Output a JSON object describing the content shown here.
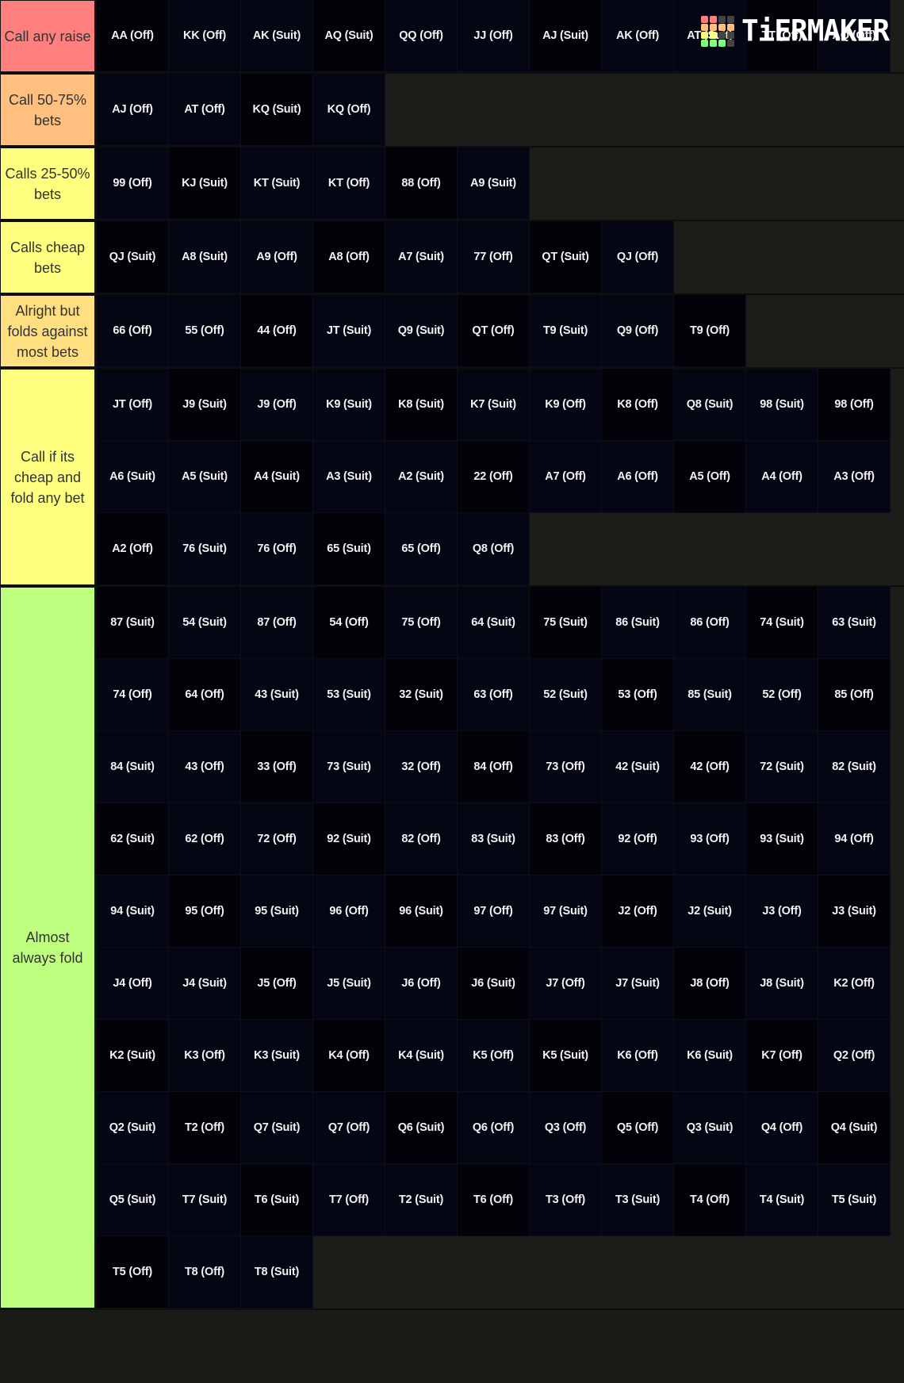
{
  "logo": {
    "text": "TiERMAKER",
    "grid_colors": [
      "#ff7f7f",
      "#ff7f7f",
      "#444444",
      "#444444",
      "#ffbf7f",
      "#ffbf7f",
      "#ffbf7f",
      "#ffbf7f",
      "#ffff7f",
      "#ffff7f",
      "#444444",
      "#444444",
      "#7fff7f",
      "#7fff7f",
      "#7fff7f",
      "#444444"
    ]
  },
  "tiers": [
    {
      "label": "Call any raise",
      "color": "#ff7f7f",
      "items": [
        "AA (Off)",
        "KK (Off)",
        "AK (Suit)",
        "AQ (Suit)",
        "QQ (Off)",
        "JJ (Off)",
        "AJ (Suit)",
        "AK (Off)",
        "AT (Suit)",
        "TT (Off)",
        "AQ (Off)"
      ]
    },
    {
      "label": "Call 50-75% bets",
      "color": "#ffbf7f",
      "items": [
        "AJ (Off)",
        "AT (Off)",
        "KQ (Suit)",
        "KQ (Off)"
      ]
    },
    {
      "label": "Calls 25-50% bets",
      "color": "#ffff7f",
      "items": [
        "99 (Off)",
        "KJ (Suit)",
        "KT (Suit)",
        "KT (Off)",
        "88 (Off)",
        "A9 (Suit)"
      ]
    },
    {
      "label": "Calls cheap bets",
      "color": "#ffff7f",
      "items": [
        "QJ (Suit)",
        "A8 (Suit)",
        "A9 (Off)",
        "A8 (Off)",
        "A7 (Suit)",
        "77 (Off)",
        "QT (Suit)",
        "QJ (Off)"
      ]
    },
    {
      "label": "Alright but folds against most bets",
      "color": "#ffdf80",
      "items": [
        "66 (Off)",
        "55 (Off)",
        "44 (Off)",
        "JT (Suit)",
        "Q9 (Suit)",
        "QT (Off)",
        "T9 (Suit)",
        "Q9 (Off)",
        "T9 (Off)"
      ]
    },
    {
      "label": "Call if its cheap and fold any bet",
      "color": "#ffff7f",
      "items": [
        "JT (Off)",
        "J9 (Suit)",
        "J9 (Off)",
        "K9 (Suit)",
        "K8 (Suit)",
        "K7 (Suit)",
        "K9 (Off)",
        "K8 (Off)",
        "Q8 (Suit)",
        "98 (Suit)",
        "98 (Off)",
        "A6 (Suit)",
        "A5 (Suit)",
        "A4 (Suit)",
        "A3 (Suit)",
        "A2 (Suit)",
        "22 (Off)",
        "A7 (Off)",
        "A6 (Off)",
        "A5 (Off)",
        "A4 (Off)",
        "A3 (Off)",
        "A2 (Off)",
        "76 (Suit)",
        "76 (Off)",
        "65 (Suit)",
        "65 (Off)",
        "Q8 (Off)"
      ]
    },
    {
      "label": "Almost always fold",
      "color": "#bfff7f",
      "items": [
        "87 (Suit)",
        "54 (Suit)",
        "87 (Off)",
        "54 (Off)",
        "75 (Off)",
        "64 (Suit)",
        "75 (Suit)",
        "86 (Suit)",
        "86 (Off)",
        "74 (Suit)",
        "63 (Suit)",
        "74 (Off)",
        "64 (Off)",
        "43 (Suit)",
        "53 (Suit)",
        "32 (Suit)",
        "63 (Off)",
        "52 (Suit)",
        "53 (Off)",
        "85 (Suit)",
        "52 (Off)",
        "85 (Off)",
        "84 (Suit)",
        "43 (Off)",
        "33 (Off)",
        "73 (Suit)",
        "32 (Off)",
        "84 (Off)",
        "73 (Off)",
        "42 (Suit)",
        "42 (Off)",
        "72 (Suit)",
        "82 (Suit)",
        "62 (Suit)",
        "62 (Off)",
        "72 (Off)",
        "92 (Suit)",
        "82 (Off)",
        "83 (Suit)",
        "83 (Off)",
        "92 (Off)",
        "93 (Off)",
        "93 (Suit)",
        "94 (Off)",
        "94 (Suit)",
        "95 (Off)",
        "95 (Suit)",
        "96 (Off)",
        "96 (Suit)",
        "97 (Off)",
        "97 (Suit)",
        "J2 (Off)",
        "J2 (Suit)",
        "J3 (Off)",
        "J3 (Suit)",
        "J4 (Off)",
        "J4 (Suit)",
        "J5 (Off)",
        "J5 (Suit)",
        "J6 (Off)",
        "J6 (Suit)",
        "J7 (Off)",
        "J7 (Suit)",
        "J8 (Off)",
        "J8 (Suit)",
        "K2 (Off)",
        "K2 (Suit)",
        "K3 (Off)",
        "K3 (Suit)",
        "K4 (Off)",
        "K4 (Suit)",
        "K5 (Off)",
        "K5 (Suit)",
        "K6 (Off)",
        "K6 (Suit)",
        "K7 (Off)",
        "Q2 (Off)",
        "Q2 (Suit)",
        "T2 (Off)",
        "Q7 (Suit)",
        "Q7 (Off)",
        "Q6 (Suit)",
        "Q6 (Off)",
        "Q3 (Off)",
        "Q5 (Off)",
        "Q3 (Suit)",
        "Q4 (Off)",
        "Q4 (Suit)",
        "Q5 (Suit)",
        "T7 (Suit)",
        "T6 (Suit)",
        "T7 (Off)",
        "T2 (Suit)",
        "T6 (Off)",
        "T3 (Off)",
        "T3 (Suit)",
        "T4 (Off)",
        "T4 (Suit)",
        "T5 (Suit)",
        "T5 (Off)",
        "T8 (Off)",
        "T8 (Suit)"
      ]
    }
  ]
}
